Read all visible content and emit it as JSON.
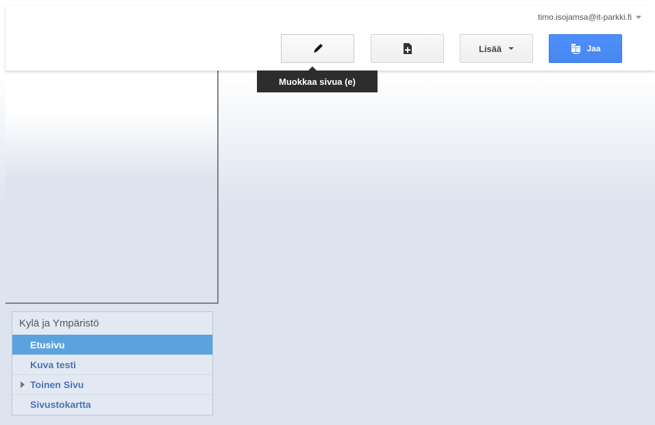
{
  "account": {
    "email": "timo.isojamsa@it-parkki.fi"
  },
  "toolbar": {
    "edit_icon": "pencil-icon",
    "new_page_icon": "new-page-icon",
    "more_label": "Lisää",
    "share_label": "Jaa",
    "share_icon": "share-building-icon"
  },
  "tooltip": {
    "text": "Muokkaa sivua (e)"
  },
  "navigation": {
    "title": "Kylä ja Ympäristö",
    "items": [
      {
        "label": "Etusivu",
        "selected": true
      },
      {
        "label": "Kuva testi",
        "selected": false
      },
      {
        "label": "Toinen Sivu",
        "selected": false,
        "expandable": true
      },
      {
        "label": "Sivustokartta",
        "selected": false
      }
    ]
  },
  "colors": {
    "accent_blue": "#4d90fe",
    "selected_item": "#5ba3df",
    "link_color": "#4a73b3",
    "tooltip_bg": "#2d2d2d"
  }
}
